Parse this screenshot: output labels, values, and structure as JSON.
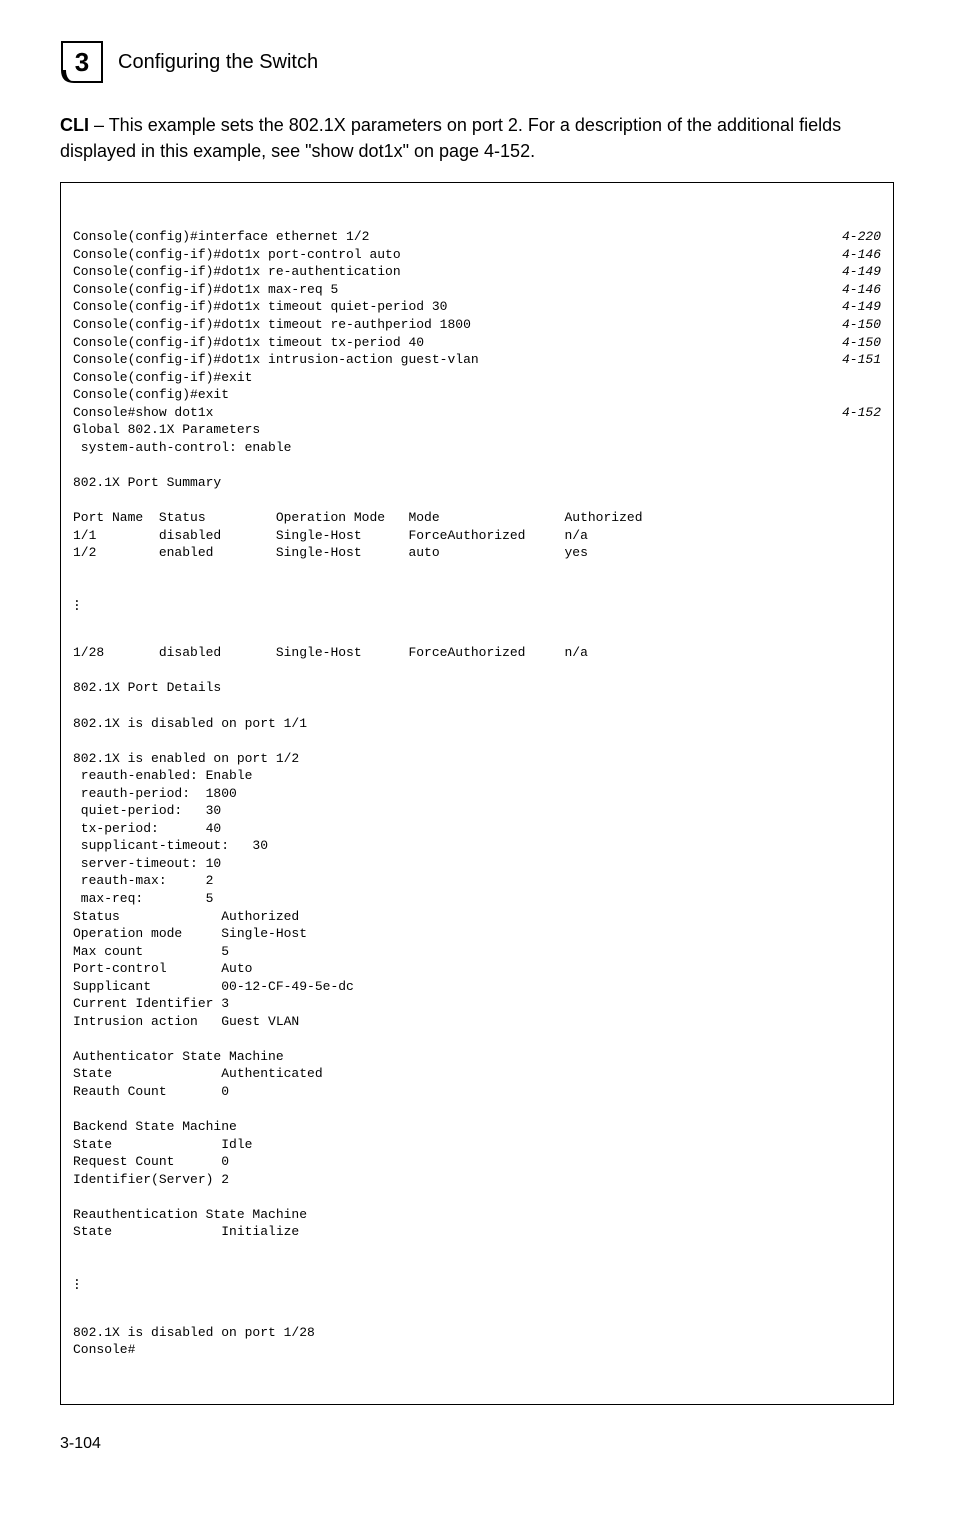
{
  "header": {
    "chapter_number": "3",
    "title": "Configuring the Switch"
  },
  "intro": {
    "prefix_bold": "CLI",
    "text": " – This example sets the 802.1X parameters on port 2. For a description of the additional fields displayed in this example, see \"show dot1x\" on page 4-152."
  },
  "code": {
    "lines": [
      {
        "left": "Console(config)#interface ethernet 1/2",
        "right": "4-220"
      },
      {
        "left": "Console(config-if)#dot1x port-control auto",
        "right": "4-146"
      },
      {
        "left": "Console(config-if)#dot1x re-authentication",
        "right": "4-149"
      },
      {
        "left": "Console(config-if)#dot1x max-req 5",
        "right": "4-146"
      },
      {
        "left": "Console(config-if)#dot1x timeout quiet-period 30",
        "right": "4-149"
      },
      {
        "left": "Console(config-if)#dot1x timeout re-authperiod 1800",
        "right": "4-150"
      },
      {
        "left": "Console(config-if)#dot1x timeout tx-period 40",
        "right": "4-150"
      },
      {
        "left": "Console(config-if)#dot1x intrusion-action guest-vlan",
        "right": "4-151"
      },
      {
        "left": "Console(config-if)#exit",
        "right": ""
      },
      {
        "left": "Console(config)#exit",
        "right": ""
      },
      {
        "left": "Console#show dot1x",
        "right": "4-152"
      },
      {
        "left": "Global 802.1X Parameters",
        "right": ""
      },
      {
        "left": " system-auth-control: enable",
        "right": ""
      },
      {
        "left": "",
        "right": ""
      },
      {
        "left": "802.1X Port Summary",
        "right": ""
      },
      {
        "left": "",
        "right": ""
      },
      {
        "left": "Port Name  Status         Operation Mode   Mode                Authorized",
        "right": ""
      },
      {
        "left": "1/1        disabled       Single-Host      ForceAuthorized     n/a",
        "right": ""
      },
      {
        "left": "1/2        enabled        Single-Host      auto                yes",
        "right": ""
      }
    ],
    "after_vdots1": [
      {
        "left": "1/28       disabled       Single-Host      ForceAuthorized     n/a",
        "right": ""
      },
      {
        "left": "",
        "right": ""
      },
      {
        "left": "802.1X Port Details",
        "right": ""
      },
      {
        "left": "",
        "right": ""
      },
      {
        "left": "802.1X is disabled on port 1/1",
        "right": ""
      },
      {
        "left": "",
        "right": ""
      },
      {
        "left": "802.1X is enabled on port 1/2",
        "right": ""
      },
      {
        "left": " reauth-enabled: Enable",
        "right": ""
      },
      {
        "left": " reauth-period:  1800",
        "right": ""
      },
      {
        "left": " quiet-period:   30",
        "right": ""
      },
      {
        "left": " tx-period:      40",
        "right": ""
      },
      {
        "left": " supplicant-timeout:   30",
        "right": ""
      },
      {
        "left": " server-timeout: 10",
        "right": ""
      },
      {
        "left": " reauth-max:     2",
        "right": ""
      },
      {
        "left": " max-req:        5",
        "right": ""
      },
      {
        "left": "Status             Authorized",
        "right": ""
      },
      {
        "left": "Operation mode     Single-Host",
        "right": ""
      },
      {
        "left": "Max count          5",
        "right": ""
      },
      {
        "left": "Port-control       Auto",
        "right": ""
      },
      {
        "left": "Supplicant         00-12-CF-49-5e-dc",
        "right": ""
      },
      {
        "left": "Current Identifier 3",
        "right": ""
      },
      {
        "left": "Intrusion action   Guest VLAN",
        "right": ""
      },
      {
        "left": "",
        "right": ""
      },
      {
        "left": "Authenticator State Machine",
        "right": ""
      },
      {
        "left": "State              Authenticated",
        "right": ""
      },
      {
        "left": "Reauth Count       0",
        "right": ""
      },
      {
        "left": "",
        "right": ""
      },
      {
        "left": "Backend State Machine",
        "right": ""
      },
      {
        "left": "State              Idle",
        "right": ""
      },
      {
        "left": "Request Count      0",
        "right": ""
      },
      {
        "left": "Identifier(Server) 2",
        "right": ""
      },
      {
        "left": "",
        "right": ""
      },
      {
        "left": "Reauthentication State Machine",
        "right": ""
      },
      {
        "left": "State              Initialize",
        "right": ""
      }
    ],
    "after_vdots2": [
      {
        "left": "802.1X is disabled on port 1/28",
        "right": ""
      },
      {
        "left": "Console#",
        "right": ""
      }
    ]
  },
  "footer": {
    "page_number": "3-104"
  }
}
